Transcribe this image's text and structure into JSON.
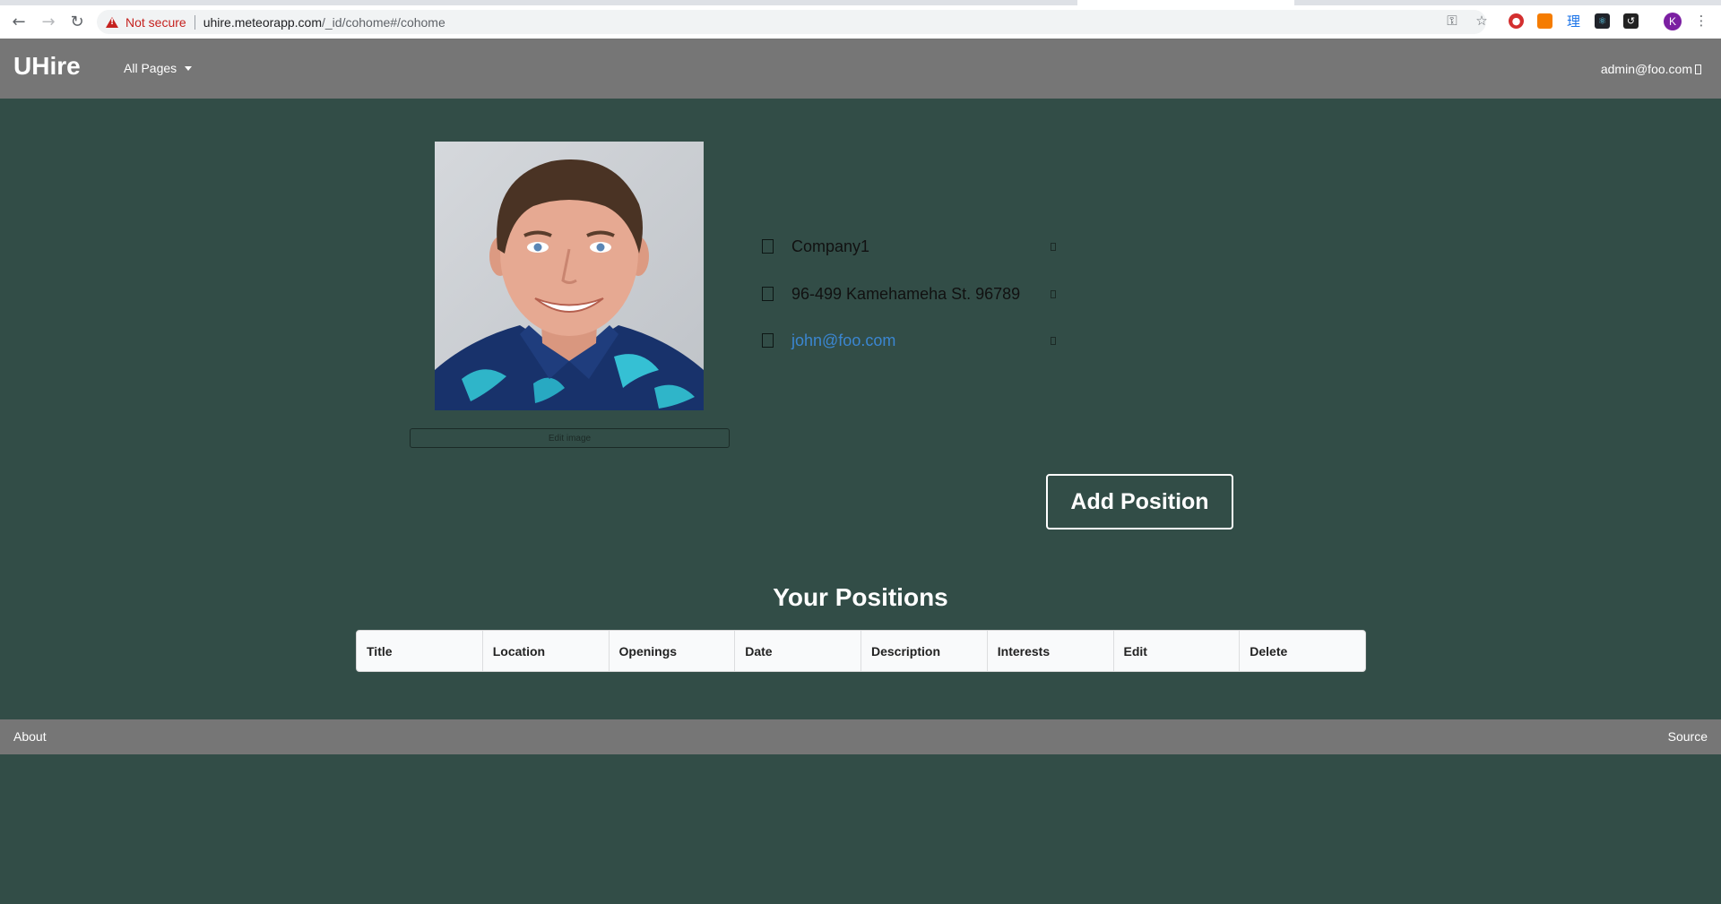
{
  "browser": {
    "security_label": "Not secure",
    "url_host": "uhire.meteorapp.com",
    "url_path": "/_id/cohome#/cohome",
    "profile_initial": "K",
    "ext_chinese_char": "理"
  },
  "nav": {
    "brand": "UHire",
    "pages_menu": "All Pages",
    "user_email": "admin@foo.com"
  },
  "profile": {
    "edit_image_label": "Edit image",
    "company": "Company1",
    "address": "96-499 Kamehameha St. 96789",
    "email": "john@foo.com"
  },
  "actions": {
    "add_position_label": "Add Position"
  },
  "positions": {
    "title": "Your Positions",
    "columns": [
      "Title",
      "Location",
      "Openings",
      "Date",
      "Description",
      "Interests",
      "Edit",
      "Delete"
    ]
  },
  "footer": {
    "about": "About",
    "source": "Source"
  },
  "colors": {
    "page_bg": "#324d47",
    "nav_bg": "#767676",
    "link": "#3b86d1"
  }
}
